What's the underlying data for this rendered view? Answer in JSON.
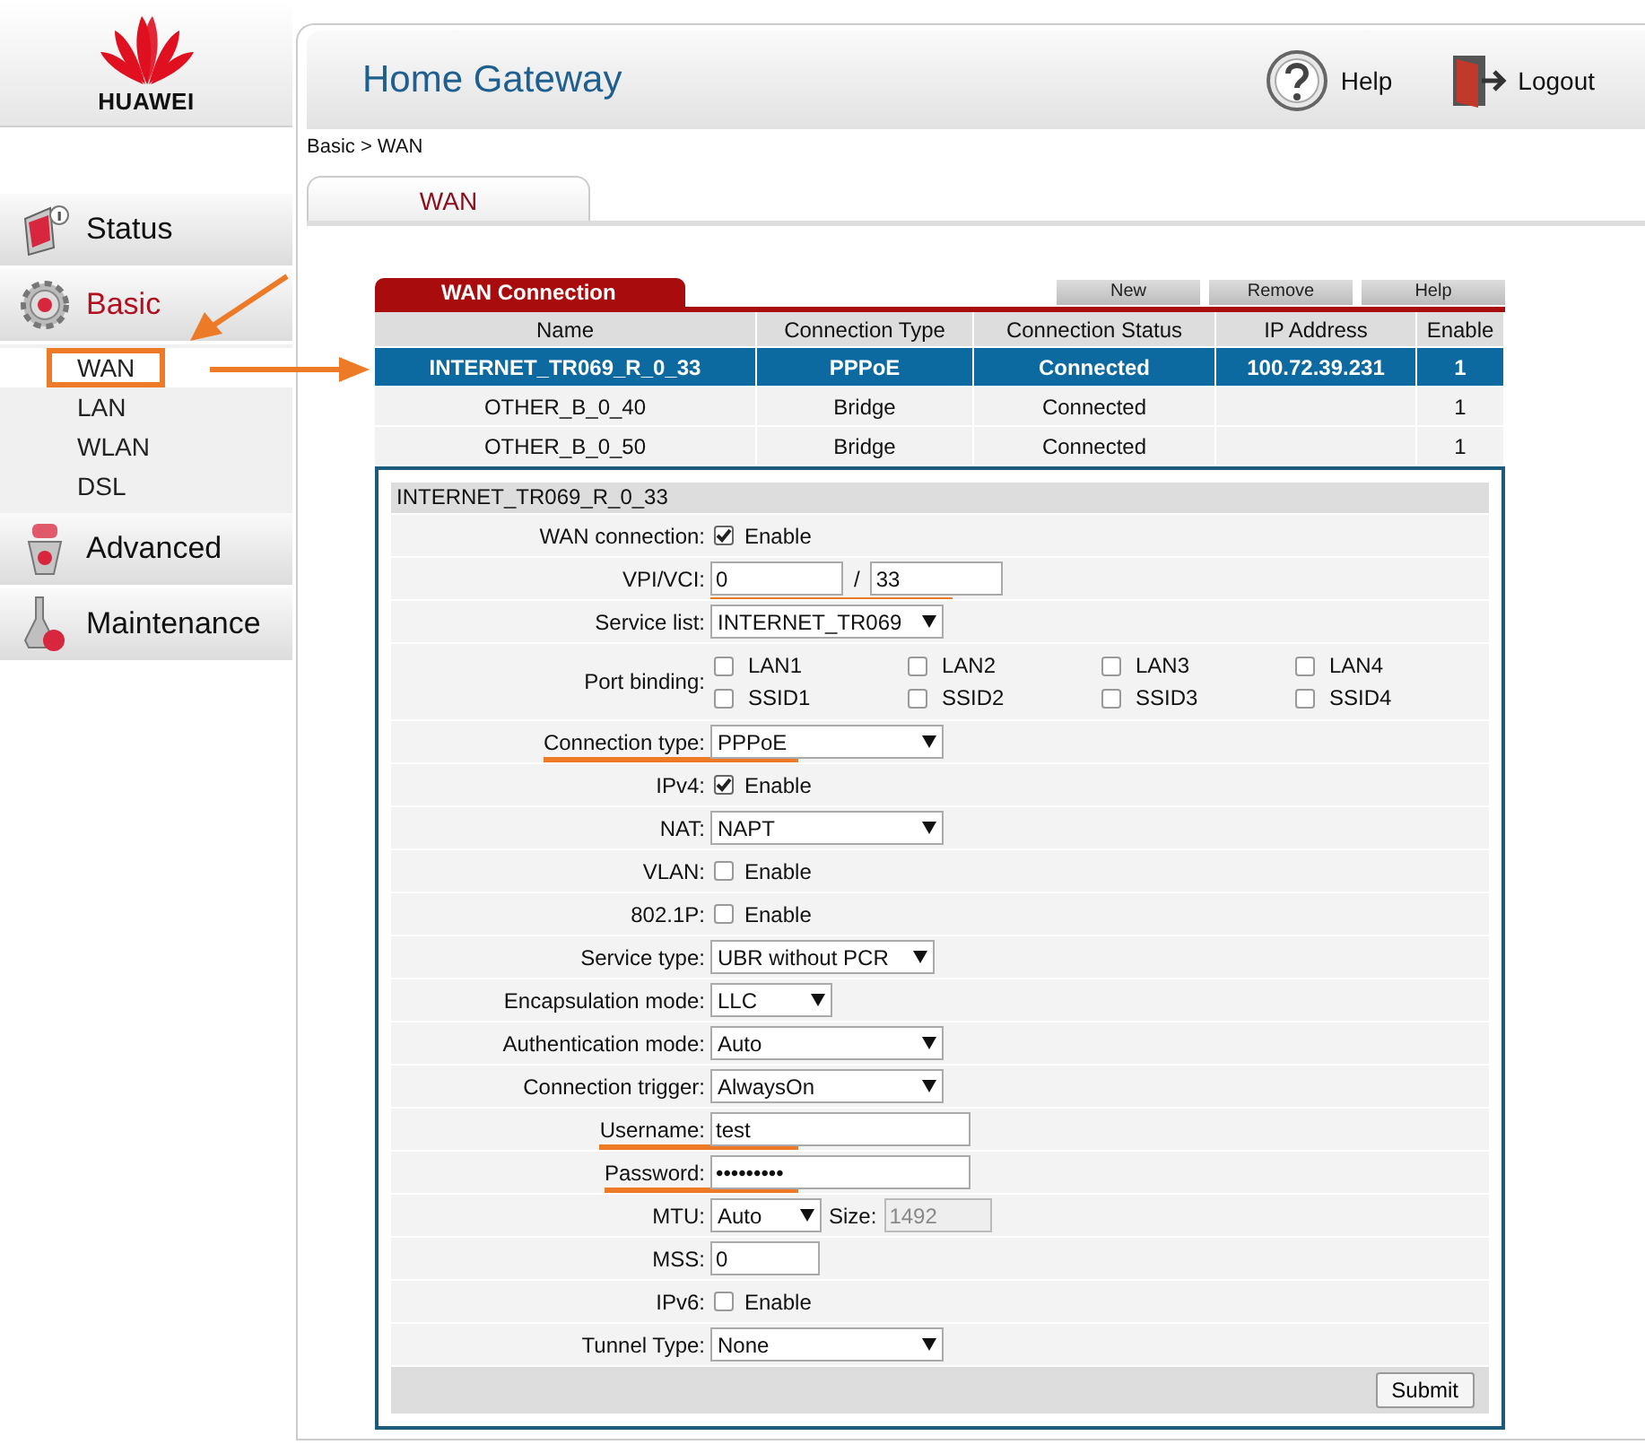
{
  "logo": {
    "text": "HUAWEI"
  },
  "header": {
    "title": "Home Gateway",
    "help": "Help",
    "logout": "Logout"
  },
  "breadcrumb": "Basic > WAN",
  "tabs": [
    {
      "label": "WAN",
      "selected": true
    }
  ],
  "nav": {
    "sections": [
      {
        "label": "Status",
        "selected": false
      },
      {
        "label": "Basic",
        "selected": true,
        "children": [
          {
            "label": "WAN",
            "selected": true,
            "highlighted": true
          },
          {
            "label": "LAN",
            "selected": false,
            "highlighted": false
          },
          {
            "label": "WLAN",
            "selected": false,
            "highlighted": false
          },
          {
            "label": "DSL",
            "selected": false,
            "highlighted": false
          }
        ]
      },
      {
        "label": "Advanced",
        "selected": false
      },
      {
        "label": "Maintenance",
        "selected": false
      }
    ]
  },
  "connections": {
    "title": "WAN Connection",
    "buttons": [
      "New",
      "Remove",
      "Help"
    ],
    "columns": [
      "Name",
      "Connection Type",
      "Connection Status",
      "IP Address",
      "Enable"
    ],
    "rows": [
      {
        "cells": [
          "INTERNET_TR069_R_0_33",
          "PPPoE",
          "Connected",
          "100.72.39.231",
          "1"
        ],
        "selected": true
      },
      {
        "cells": [
          "OTHER_B_0_40",
          "Bridge",
          "Connected",
          "",
          "1"
        ],
        "selected": false
      },
      {
        "cells": [
          "OTHER_B_0_50",
          "Bridge",
          "Connected",
          "",
          "1"
        ],
        "selected": false
      }
    ]
  },
  "form": {
    "title": "INTERNET_TR069_R_0_33",
    "submit": "Submit",
    "fields": [
      {
        "kind": "checkbox",
        "label": "WAN connection:",
        "text": "Enable",
        "checked": true
      },
      {
        "kind": "pair",
        "label": "VPI/VCI:",
        "value": "0",
        "separator": "/",
        "value2": "33",
        "underlined": true
      },
      {
        "kind": "select",
        "label": "Service list:",
        "value": "INTERNET_TR069"
      },
      {
        "kind": "checkgrid",
        "label": "Port binding:",
        "options": [
          {
            "text": "LAN1",
            "checked": false
          },
          {
            "text": "LAN2",
            "checked": false
          },
          {
            "text": "LAN3",
            "checked": false
          },
          {
            "text": "LAN4",
            "checked": false
          },
          {
            "text": "SSID1",
            "checked": false
          },
          {
            "text": "SSID2",
            "checked": false
          },
          {
            "text": "SSID3",
            "checked": false
          },
          {
            "text": "SSID4",
            "checked": false
          }
        ]
      },
      {
        "kind": "select",
        "label": "Connection type:",
        "value": "PPPoE",
        "underlined": true
      },
      {
        "kind": "checkbox",
        "label": "IPv4:",
        "text": "Enable",
        "checked": true
      },
      {
        "kind": "select",
        "label": "NAT:",
        "value": "NAPT"
      },
      {
        "kind": "checkbox",
        "label": "VLAN:",
        "text": "Enable",
        "checked": false
      },
      {
        "kind": "checkbox",
        "label": "802.1P:",
        "text": "Enable",
        "checked": false
      },
      {
        "kind": "select",
        "label": "Service type:",
        "value": "UBR without PCR"
      },
      {
        "kind": "select",
        "label": "Encapsulation mode:",
        "value": "LLC"
      },
      {
        "kind": "select",
        "label": "Authentication mode:",
        "value": "Auto"
      },
      {
        "kind": "select",
        "label": "Connection trigger:",
        "value": "AlwaysOn"
      },
      {
        "kind": "text",
        "label": "Username:",
        "value": "test",
        "underlined": true
      },
      {
        "kind": "password",
        "label": "Password:",
        "value": "•••••••••",
        "underlined": true
      },
      {
        "kind": "mtu",
        "label": "MTU:",
        "value": "Auto",
        "size_label": "Size:",
        "size": "1492"
      },
      {
        "kind": "text",
        "label": "MSS:",
        "value": "0"
      },
      {
        "kind": "checkbox",
        "label": "IPv6:",
        "text": "Enable",
        "checked": false
      },
      {
        "kind": "select",
        "label": "Tunnel Type:",
        "value": "None"
      }
    ]
  }
}
